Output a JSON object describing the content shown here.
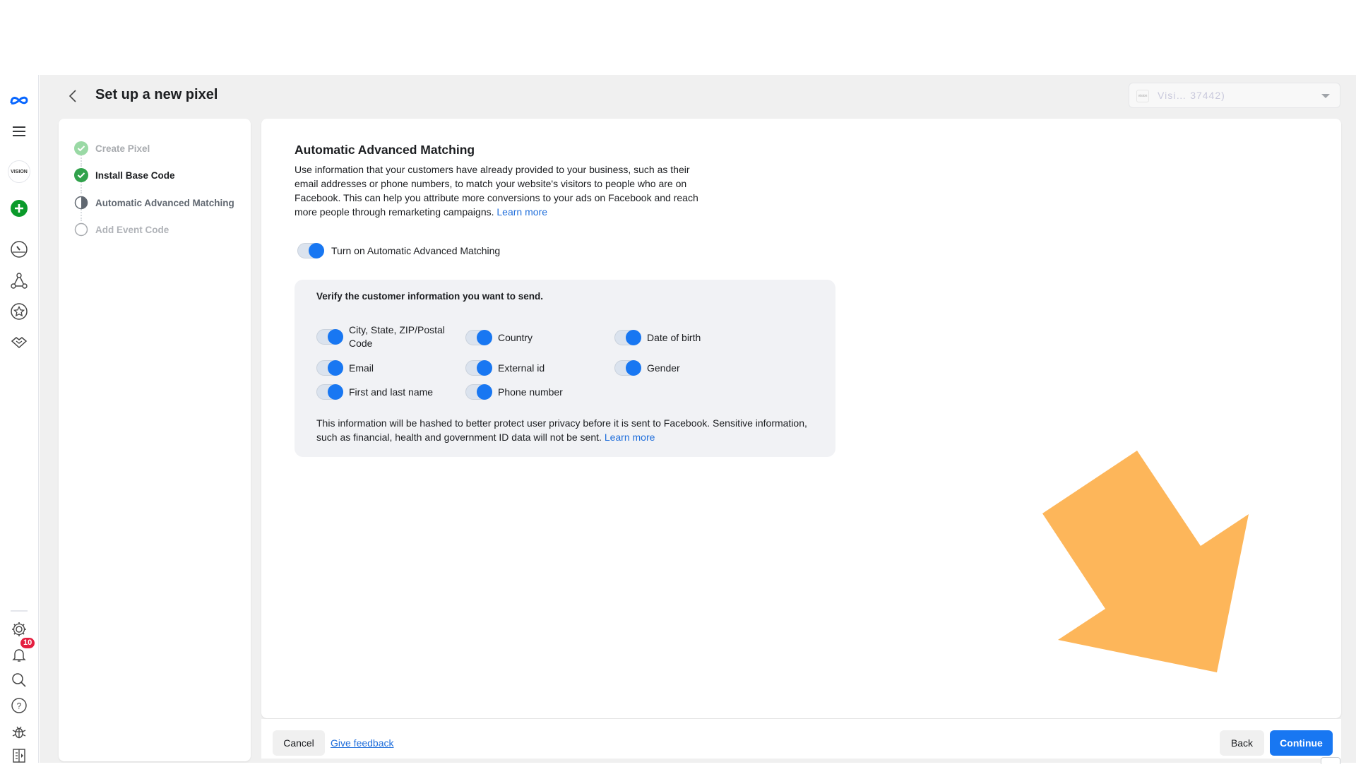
{
  "page": {
    "title": "Set up a new pixel",
    "account_selector": {
      "logo_text": "vision",
      "value": "Visi…                 37442)"
    }
  },
  "sidebar": {
    "top_icons": [
      "meta-logo-icon",
      "menu-icon",
      "account-avatar",
      "create-icon",
      "dashboard-gauge-icon",
      "network-icon",
      "star-icon",
      "handshake-icon"
    ],
    "avatar_text": "VISION",
    "bottom_icons": [
      "gear-icon",
      "bell-icon",
      "search-icon",
      "help-icon",
      "bug-icon",
      "panel-toggle-icon"
    ],
    "notification_count": "10"
  },
  "steps": [
    {
      "label": "Create Pixel",
      "state": "done-faded"
    },
    {
      "label": "Install Base Code",
      "state": "done"
    },
    {
      "label": "Automatic Advanced Matching",
      "state": "current"
    },
    {
      "label": "Add Event Code",
      "state": "pending"
    }
  ],
  "content": {
    "title": "Automatic Advanced Matching",
    "description": "Use information that your customers have already provided to your business, such as their email addresses or phone numbers, to match your website's visitors to people who are on Facebook. This can help you attribute more conversions to your ads on Facebook and reach more people through remarketing campaigns.",
    "learn_more": "Learn more",
    "main_toggle_label": "Turn on Automatic Advanced Matching",
    "main_toggle_on": true,
    "verify": {
      "heading": "Verify the customer information you want to send.",
      "fields": [
        {
          "label": "City, State, ZIP/Postal Code",
          "on": true
        },
        {
          "label": "Country",
          "on": true
        },
        {
          "label": "Date of birth",
          "on": true
        },
        {
          "label": "Email",
          "on": true
        },
        {
          "label": "External id",
          "on": true
        },
        {
          "label": "Gender",
          "on": true
        },
        {
          "label": "First and last name",
          "on": true
        },
        {
          "label": "Phone number",
          "on": true
        }
      ],
      "note": "This information will be hashed to better protect user privacy before it is sent to Facebook. Sensitive information, such as financial, health and government ID data will not be sent.",
      "note_link": "Learn more"
    }
  },
  "footer": {
    "cancel": "Cancel",
    "feedback": "Give feedback",
    "back": "Back",
    "continue": "Continue"
  },
  "annotation": {
    "type": "arrow",
    "color": "#FDB65A",
    "points_to": "continue-button"
  },
  "colors": {
    "accent": "#1877F2",
    "success": "#31A24C",
    "link": "#216FDB"
  }
}
